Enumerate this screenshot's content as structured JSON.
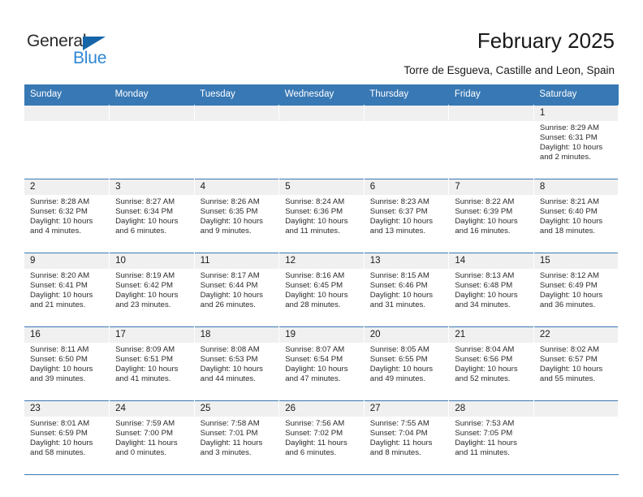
{
  "brand": {
    "name_part1": "General",
    "name_part2": "Blue",
    "triangle_color": "#1565a8",
    "blue_color": "#2f86d6"
  },
  "header": {
    "title": "February 2025",
    "subtitle": "Torre de Esgueva, Castille and Leon, Spain"
  },
  "theme": {
    "header_blue": "#3878b4",
    "daynum_band": "#f0f0f0",
    "text": "#2b2b2b"
  },
  "weekdays": [
    "Sunday",
    "Monday",
    "Tuesday",
    "Wednesday",
    "Thursday",
    "Friday",
    "Saturday"
  ],
  "weeks": [
    [
      {
        "day": "",
        "sunrise": "",
        "sunset": "",
        "daylight1": "",
        "daylight2": ""
      },
      {
        "day": "",
        "sunrise": "",
        "sunset": "",
        "daylight1": "",
        "daylight2": ""
      },
      {
        "day": "",
        "sunrise": "",
        "sunset": "",
        "daylight1": "",
        "daylight2": ""
      },
      {
        "day": "",
        "sunrise": "",
        "sunset": "",
        "daylight1": "",
        "daylight2": ""
      },
      {
        "day": "",
        "sunrise": "",
        "sunset": "",
        "daylight1": "",
        "daylight2": ""
      },
      {
        "day": "",
        "sunrise": "",
        "sunset": "",
        "daylight1": "",
        "daylight2": ""
      },
      {
        "day": "1",
        "sunrise": "Sunrise: 8:29 AM",
        "sunset": "Sunset: 6:31 PM",
        "daylight1": "Daylight: 10 hours",
        "daylight2": "and 2 minutes."
      }
    ],
    [
      {
        "day": "2",
        "sunrise": "Sunrise: 8:28 AM",
        "sunset": "Sunset: 6:32 PM",
        "daylight1": "Daylight: 10 hours",
        "daylight2": "and 4 minutes."
      },
      {
        "day": "3",
        "sunrise": "Sunrise: 8:27 AM",
        "sunset": "Sunset: 6:34 PM",
        "daylight1": "Daylight: 10 hours",
        "daylight2": "and 6 minutes."
      },
      {
        "day": "4",
        "sunrise": "Sunrise: 8:26 AM",
        "sunset": "Sunset: 6:35 PM",
        "daylight1": "Daylight: 10 hours",
        "daylight2": "and 9 minutes."
      },
      {
        "day": "5",
        "sunrise": "Sunrise: 8:24 AM",
        "sunset": "Sunset: 6:36 PM",
        "daylight1": "Daylight: 10 hours",
        "daylight2": "and 11 minutes."
      },
      {
        "day": "6",
        "sunrise": "Sunrise: 8:23 AM",
        "sunset": "Sunset: 6:37 PM",
        "daylight1": "Daylight: 10 hours",
        "daylight2": "and 13 minutes."
      },
      {
        "day": "7",
        "sunrise": "Sunrise: 8:22 AM",
        "sunset": "Sunset: 6:39 PM",
        "daylight1": "Daylight: 10 hours",
        "daylight2": "and 16 minutes."
      },
      {
        "day": "8",
        "sunrise": "Sunrise: 8:21 AM",
        "sunset": "Sunset: 6:40 PM",
        "daylight1": "Daylight: 10 hours",
        "daylight2": "and 18 minutes."
      }
    ],
    [
      {
        "day": "9",
        "sunrise": "Sunrise: 8:20 AM",
        "sunset": "Sunset: 6:41 PM",
        "daylight1": "Daylight: 10 hours",
        "daylight2": "and 21 minutes."
      },
      {
        "day": "10",
        "sunrise": "Sunrise: 8:19 AM",
        "sunset": "Sunset: 6:42 PM",
        "daylight1": "Daylight: 10 hours",
        "daylight2": "and 23 minutes."
      },
      {
        "day": "11",
        "sunrise": "Sunrise: 8:17 AM",
        "sunset": "Sunset: 6:44 PM",
        "daylight1": "Daylight: 10 hours",
        "daylight2": "and 26 minutes."
      },
      {
        "day": "12",
        "sunrise": "Sunrise: 8:16 AM",
        "sunset": "Sunset: 6:45 PM",
        "daylight1": "Daylight: 10 hours",
        "daylight2": "and 28 minutes."
      },
      {
        "day": "13",
        "sunrise": "Sunrise: 8:15 AM",
        "sunset": "Sunset: 6:46 PM",
        "daylight1": "Daylight: 10 hours",
        "daylight2": "and 31 minutes."
      },
      {
        "day": "14",
        "sunrise": "Sunrise: 8:13 AM",
        "sunset": "Sunset: 6:48 PM",
        "daylight1": "Daylight: 10 hours",
        "daylight2": "and 34 minutes."
      },
      {
        "day": "15",
        "sunrise": "Sunrise: 8:12 AM",
        "sunset": "Sunset: 6:49 PM",
        "daylight1": "Daylight: 10 hours",
        "daylight2": "and 36 minutes."
      }
    ],
    [
      {
        "day": "16",
        "sunrise": "Sunrise: 8:11 AM",
        "sunset": "Sunset: 6:50 PM",
        "daylight1": "Daylight: 10 hours",
        "daylight2": "and 39 minutes."
      },
      {
        "day": "17",
        "sunrise": "Sunrise: 8:09 AM",
        "sunset": "Sunset: 6:51 PM",
        "daylight1": "Daylight: 10 hours",
        "daylight2": "and 41 minutes."
      },
      {
        "day": "18",
        "sunrise": "Sunrise: 8:08 AM",
        "sunset": "Sunset: 6:53 PM",
        "daylight1": "Daylight: 10 hours",
        "daylight2": "and 44 minutes."
      },
      {
        "day": "19",
        "sunrise": "Sunrise: 8:07 AM",
        "sunset": "Sunset: 6:54 PM",
        "daylight1": "Daylight: 10 hours",
        "daylight2": "and 47 minutes."
      },
      {
        "day": "20",
        "sunrise": "Sunrise: 8:05 AM",
        "sunset": "Sunset: 6:55 PM",
        "daylight1": "Daylight: 10 hours",
        "daylight2": "and 49 minutes."
      },
      {
        "day": "21",
        "sunrise": "Sunrise: 8:04 AM",
        "sunset": "Sunset: 6:56 PM",
        "daylight1": "Daylight: 10 hours",
        "daylight2": "and 52 minutes."
      },
      {
        "day": "22",
        "sunrise": "Sunrise: 8:02 AM",
        "sunset": "Sunset: 6:57 PM",
        "daylight1": "Daylight: 10 hours",
        "daylight2": "and 55 minutes."
      }
    ],
    [
      {
        "day": "23",
        "sunrise": "Sunrise: 8:01 AM",
        "sunset": "Sunset: 6:59 PM",
        "daylight1": "Daylight: 10 hours",
        "daylight2": "and 58 minutes."
      },
      {
        "day": "24",
        "sunrise": "Sunrise: 7:59 AM",
        "sunset": "Sunset: 7:00 PM",
        "daylight1": "Daylight: 11 hours",
        "daylight2": "and 0 minutes."
      },
      {
        "day": "25",
        "sunrise": "Sunrise: 7:58 AM",
        "sunset": "Sunset: 7:01 PM",
        "daylight1": "Daylight: 11 hours",
        "daylight2": "and 3 minutes."
      },
      {
        "day": "26",
        "sunrise": "Sunrise: 7:56 AM",
        "sunset": "Sunset: 7:02 PM",
        "daylight1": "Daylight: 11 hours",
        "daylight2": "and 6 minutes."
      },
      {
        "day": "27",
        "sunrise": "Sunrise: 7:55 AM",
        "sunset": "Sunset: 7:04 PM",
        "daylight1": "Daylight: 11 hours",
        "daylight2": "and 8 minutes."
      },
      {
        "day": "28",
        "sunrise": "Sunrise: 7:53 AM",
        "sunset": "Sunset: 7:05 PM",
        "daylight1": "Daylight: 11 hours",
        "daylight2": "and 11 minutes."
      },
      {
        "day": "",
        "sunrise": "",
        "sunset": "",
        "daylight1": "",
        "daylight2": ""
      }
    ]
  ]
}
